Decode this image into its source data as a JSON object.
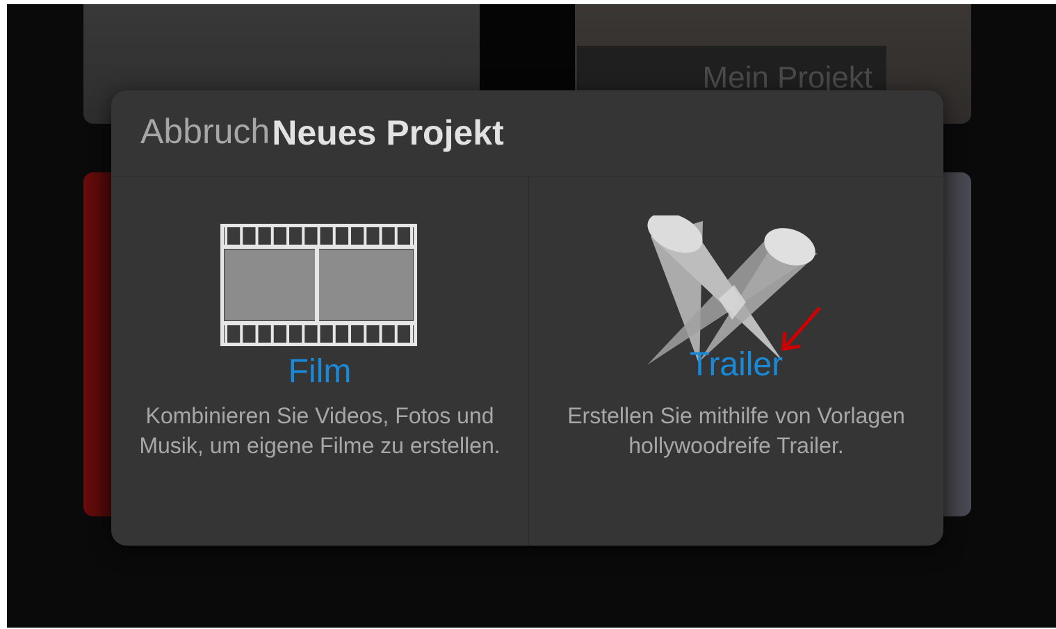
{
  "background": {
    "project_title": "Mein Projekt"
  },
  "dialog": {
    "cancel_label": "Abbruch",
    "title": "Neues Projekt",
    "options": [
      {
        "title": "Film",
        "description": "Kombinieren Sie Videos, Fotos und Musik, um eigene Filme zu erstellen.",
        "icon": "film-strip-icon"
      },
      {
        "title": "Trailer",
        "description": "Erstellen Sie mithilfe von Vorlagen hollywoodreife Trailer.",
        "icon": "spotlights-icon"
      }
    ]
  },
  "colors": {
    "accent": "#1a8ad8",
    "annotation_arrow": "#d00000",
    "dialog_bg": "#353535"
  }
}
